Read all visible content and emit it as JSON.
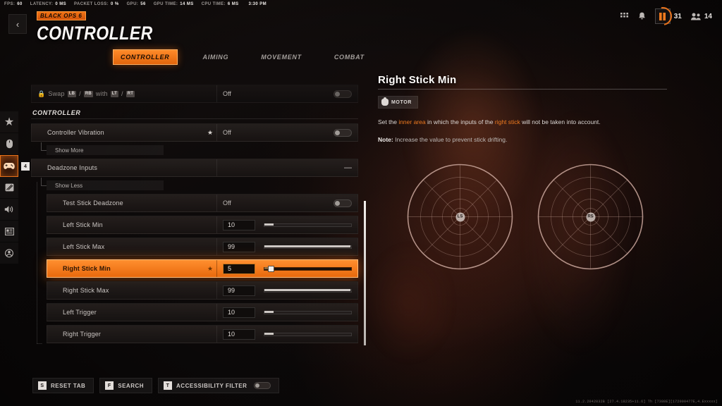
{
  "perf": [
    {
      "key": "FPS:",
      "value": "60"
    },
    {
      "key": "LATENCY:",
      "value": "0 MS"
    },
    {
      "key": "PACKET LOSS:",
      "value": "0 %"
    },
    {
      "key": "GPU:",
      "value": "56"
    },
    {
      "key": "GPU TIME:",
      "value": "14 MS"
    },
    {
      "key": "CPU TIME:",
      "value": "6 MS"
    },
    {
      "key": "",
      "value": "3:30 PM"
    }
  ],
  "header": {
    "back_label": "‹",
    "brand": "BLACK OPS 6",
    "title": "CONTROLLER",
    "battlepass_count": "31",
    "friends_count": "14"
  },
  "tabs": [
    {
      "label": "CONTROLLER",
      "active": true
    },
    {
      "label": "AIMING",
      "active": false
    },
    {
      "label": "MOVEMENT",
      "active": false
    },
    {
      "label": "COMBAT",
      "active": false
    }
  ],
  "rail": [
    {
      "name": "favorites",
      "glyph": "★",
      "active": false,
      "badge": ""
    },
    {
      "name": "mouse-keyboard",
      "glyph": "mouse",
      "active": false,
      "badge": ""
    },
    {
      "name": "controller",
      "glyph": "gamepad",
      "active": true,
      "badge": "4"
    },
    {
      "name": "graphics",
      "glyph": "display",
      "active": false,
      "badge": ""
    },
    {
      "name": "audio",
      "glyph": "speaker",
      "active": false,
      "badge": ""
    },
    {
      "name": "interface",
      "glyph": "hud",
      "active": false,
      "badge": ""
    },
    {
      "name": "account",
      "glyph": "account",
      "active": false,
      "badge": ""
    }
  ],
  "settings": {
    "swap_row": {
      "prefix": "Swap",
      "key_lb": "LB",
      "sep1": "/",
      "key_rb": "RB",
      "with": "with",
      "key_lt": "LT",
      "sep2": "/",
      "key_rt": "RT",
      "value": "Off"
    },
    "section_title": "CONTROLLER",
    "vibration": {
      "label": "Controller Vibration",
      "value": "Off",
      "starred": true
    },
    "show_more": "Show More",
    "deadzone": {
      "label": "Deadzone Inputs",
      "collapse": "—"
    },
    "show_less": "Show Less",
    "rows": [
      {
        "label": "Test Stick Deadzone",
        "type": "toggle",
        "value": "Off",
        "starred": false,
        "selected": false
      },
      {
        "label": "Left Stick Min",
        "type": "slider",
        "value": "10",
        "fill": 12,
        "starred": false,
        "selected": false
      },
      {
        "label": "Left Stick Max",
        "type": "slider",
        "value": "99",
        "fill": 99,
        "starred": false,
        "selected": false
      },
      {
        "label": "Right Stick Min",
        "type": "slider",
        "value": "5",
        "fill": 6,
        "starred": true,
        "selected": true
      },
      {
        "label": "Right Stick Max",
        "type": "slider",
        "value": "99",
        "fill": 99,
        "starred": false,
        "selected": false
      },
      {
        "label": "Left Trigger",
        "type": "slider",
        "value": "10",
        "fill": 12,
        "starred": false,
        "selected": false
      },
      {
        "label": "Right Trigger",
        "type": "slider",
        "value": "10",
        "fill": 12,
        "starred": false,
        "selected": false
      }
    ]
  },
  "info": {
    "title": "Right Stick Min",
    "chip": "MOTOR",
    "desc_1": "Set the ",
    "desc_hl_1": "inner area",
    "desc_2": " in which the inputs of the ",
    "desc_hl_2": "right stick",
    "desc_3": " will not be taken into account.",
    "note_label": "Note:",
    "note_text": " Increase the value to prevent stick drifting.",
    "stick_left_label": "LS",
    "stick_right_label": "RS"
  },
  "bottom": [
    {
      "key": "S",
      "label": "RESET TAB",
      "toggle": false
    },
    {
      "key": "F",
      "label": "SEARCH",
      "toggle": false
    },
    {
      "key": "T",
      "label": "ACCESSIBILITY FILTER",
      "toggle": true
    }
  ],
  "build_string": "11.2.2042032B [27.4.18235+11.6] Th [7380E][172000477E,4.Exxxxx]"
}
